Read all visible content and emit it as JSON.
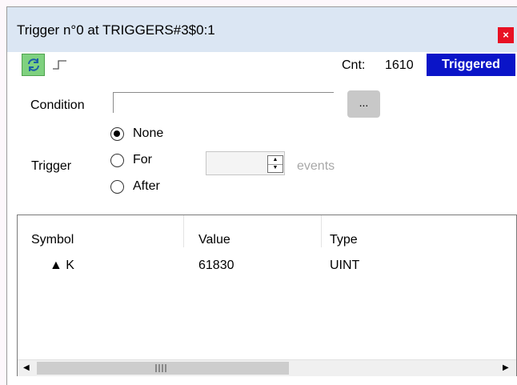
{
  "window": {
    "title": "Trigger n°0 at TRIGGERS#3$0:1",
    "close_label": "×"
  },
  "toolbar": {
    "refresh_icon": "refresh-icon",
    "edge_icon": "rising-edge-icon",
    "cnt_label": "Cnt:",
    "cnt_value": "1610",
    "status": "Triggered",
    "status_color": "#0a14c8",
    "refresh_color": "#7fd17f"
  },
  "condition": {
    "label": "Condition",
    "value": "",
    "browse_label": "..."
  },
  "trigger": {
    "label": "Trigger",
    "options": [
      {
        "label": "None",
        "selected": true
      },
      {
        "label": "For",
        "selected": false
      },
      {
        "label": "After",
        "selected": false
      }
    ],
    "count_value": "",
    "unit_label": "events"
  },
  "table": {
    "columns": [
      "Symbol",
      "Value",
      "Type"
    ],
    "rows": [
      {
        "symbol": "▲ K",
        "value": "61830",
        "type": "UINT"
      }
    ]
  }
}
